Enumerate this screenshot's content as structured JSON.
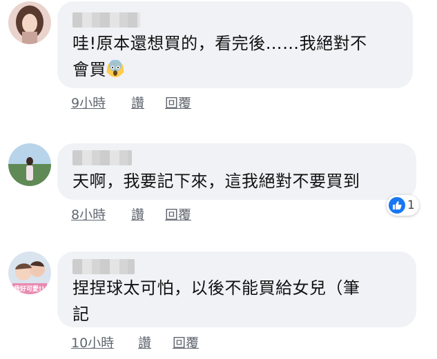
{
  "comments": [
    {
      "text": "哇!原本還想買的，看完後……我絕對不\n會買",
      "emoji": "scream-emoji",
      "time": "9小時",
      "like_label": "讚",
      "reply_label": "回覆"
    },
    {
      "text": "天啊，我要記下來，這我絕對不要買到",
      "time": "8小時",
      "like_label": "讚",
      "reply_label": "回覆",
      "reaction_count": "1",
      "reaction_icon": "thumbs-up-icon"
    },
    {
      "text": "捏捏球太可怕，以後不能買給女兒（筆\n記",
      "time": "10小時",
      "like_label": "讚",
      "reply_label": "回覆",
      "avatar_caption": "我好可愛!!"
    }
  ],
  "colors": {
    "bubble": "#f0f2f5",
    "meta_text": "#616770",
    "like_blue": "#1877f2"
  }
}
